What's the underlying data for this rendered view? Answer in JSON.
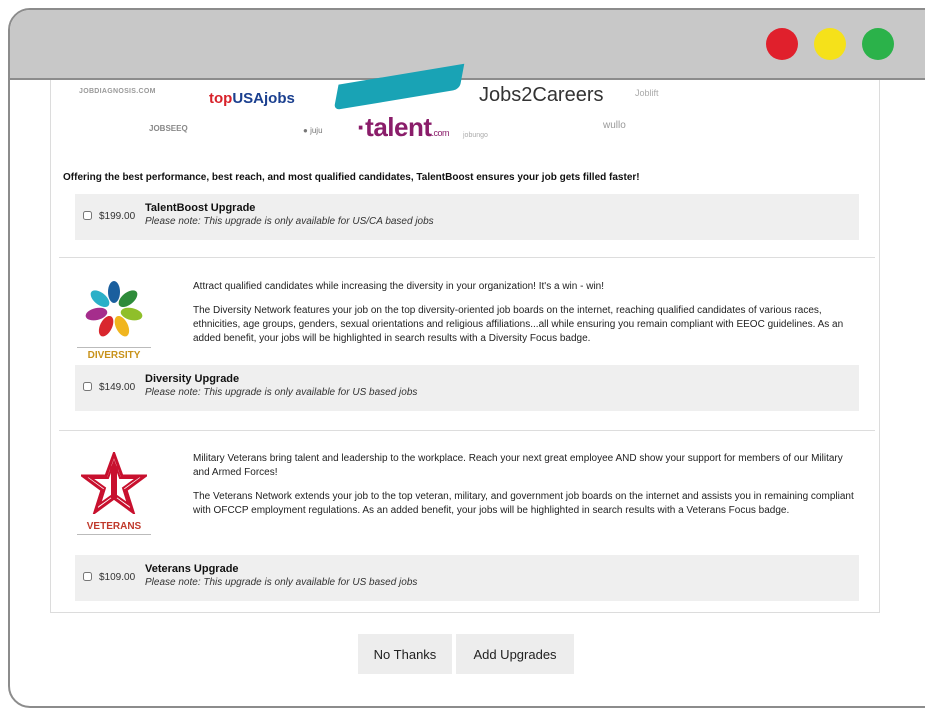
{
  "window": {
    "controls": [
      "close",
      "minimize",
      "maximize"
    ]
  },
  "logos": {
    "jobdiagnosis": "JOBDIAGNOSIS.COM",
    "topusajobs_a": "top",
    "topusajobs_b": "USAjobs",
    "jobs2careers": "Jobs2Careers",
    "joblift": "Joblift",
    "jobseeq": "JOBSEEQ",
    "juju": "juju",
    "talent": "talent",
    "talent_suffix": ".com",
    "jobungo": "jobungo",
    "wullo": "wullo"
  },
  "talentboost": {
    "intro": "Offering the best performance, best reach, and most qualified candidates, TalentBoost ensures your job gets filled faster!",
    "price": "$199.00",
    "name": "TalentBoost Upgrade",
    "note": "Please note: This upgrade is only available for US/CA based jobs"
  },
  "diversity": {
    "logo_caption": "DIVERSITY",
    "para1": "Attract qualified candidates while increasing the diversity in your organization! It's a win - win!",
    "para2": "The Diversity Network features your job on the top diversity-oriented job boards on the internet, reaching qualified candidates of various races, ethnicities, age groups, genders, sexual orientations and religious affiliations...all while ensuring you remain compliant with EEOC guidelines. As an added benefit, your jobs will be highlighted in search results with a Diversity Focus badge.",
    "price": "$149.00",
    "name": "Diversity Upgrade",
    "note": "Please note: This upgrade is only available for US based jobs"
  },
  "veterans": {
    "logo_caption": "VETERANS",
    "para1": "Military Veterans bring talent and leadership to the workplace. Reach your next great employee AND show your support for members of our Military and Armed Forces!",
    "para2": "The Veterans Network extends your job to the top veteran, military, and government job boards on the internet and assists you in remaining compliant with OFCCP employment regulations. As an added benefit, your jobs will be highlighted in search results with a Veterans Focus badge.",
    "price": "$109.00",
    "name": "Veterans Upgrade",
    "note": "Please note: This upgrade is only available for US based jobs"
  },
  "buttons": {
    "no_thanks": "No Thanks",
    "add_upgrades": "Add Upgrades"
  },
  "colors": {
    "close": "#e0202c",
    "minimize": "#f5e11a",
    "maximize": "#2bb24a",
    "button_bg": "#ededed",
    "option_bg": "#efefef"
  }
}
